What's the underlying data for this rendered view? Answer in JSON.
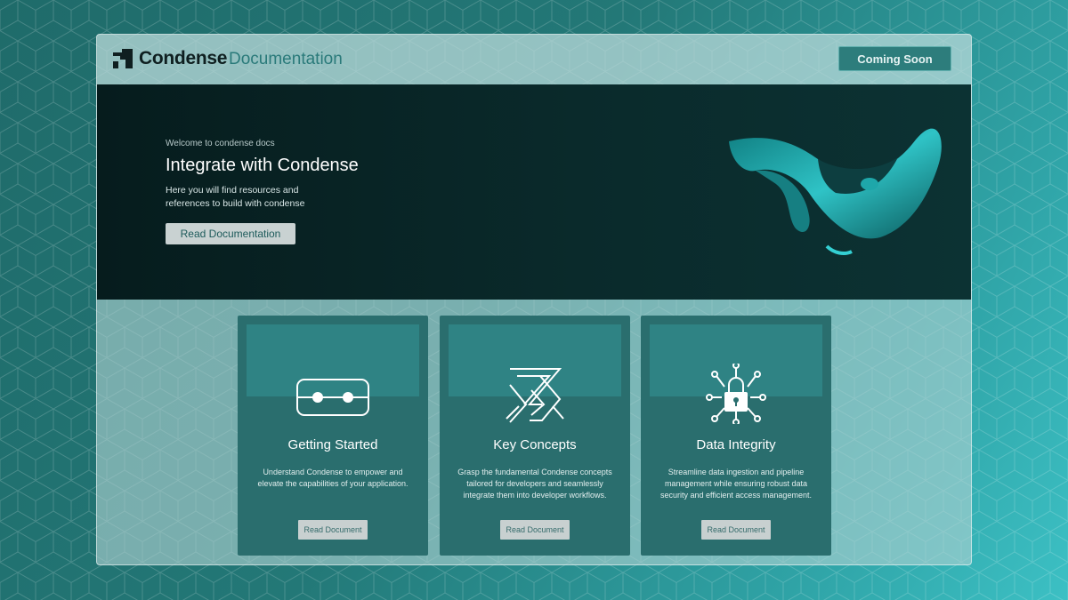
{
  "header": {
    "brand": "Condense",
    "section": "Documentation",
    "coming_soon_label": "Coming Soon"
  },
  "hero": {
    "welcome": "Welcome to condense docs",
    "title": "Integrate with Condense",
    "description": "Here you will find resources and references to build with condense",
    "button_label": "Read Documentation"
  },
  "cards": [
    {
      "icon": "toggle-dots-icon",
      "title": "Getting Started",
      "description": "Understand Condense to empower and elevate the capabilities of your application.",
      "button_label": "Read Document"
    },
    {
      "icon": "interlocking-shapes-icon",
      "title": "Key Concepts",
      "description": "Grasp the fundamental Condense concepts tailored for developers and seamlessly integrate them into developer workflows.",
      "button_label": "Read Document"
    },
    {
      "icon": "lock-network-icon",
      "title": "Data Integrity",
      "description": "Streamline data ingestion and pipeline management while ensuring robust data security and efficient access management.",
      "button_label": "Read Document"
    }
  ],
  "colors": {
    "accent": "#2d7d7c",
    "hero_bg": "#0a2a2b",
    "card_bg": "#2a6e6e"
  }
}
